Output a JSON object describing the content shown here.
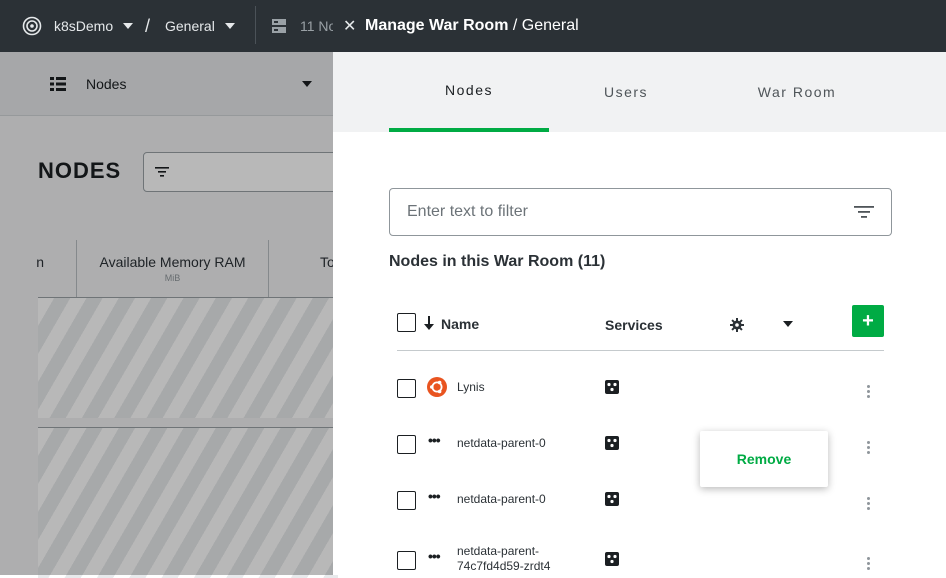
{
  "topbar": {
    "space": "k8sDemo",
    "separator": "/",
    "room": "General",
    "nodes_count_partial": "11 No"
  },
  "background": {
    "view_selector": "Nodes",
    "page_title": "NODES",
    "columns": [
      {
        "label": "n",
        "unit": ""
      },
      {
        "label": "Available Memory RAM",
        "unit": "MiB"
      },
      {
        "label": "To",
        "unit": ""
      }
    ]
  },
  "panel": {
    "title": "Manage War Room",
    "room_suffix": " / General",
    "tabs": [
      {
        "label": "Nodes",
        "active": true
      },
      {
        "label": "Users",
        "active": false
      },
      {
        "label": "War Room",
        "active": false
      }
    ],
    "filter_placeholder": "Enter text to filter",
    "section_title": "Nodes in this War Room (11)",
    "table": {
      "headers": {
        "name": "Name",
        "services": "Services"
      },
      "add_label": "+",
      "rows": [
        {
          "name": "Lynis",
          "icon": "ubuntu-icon"
        },
        {
          "name": "netdata-parent-0",
          "icon": "dots-icon"
        },
        {
          "name": "netdata-parent-0",
          "icon": "dots-icon"
        },
        {
          "name": "netdata-parent-",
          "name2": "74c7fd4d59-zrdt4",
          "icon": "dots-icon"
        }
      ]
    },
    "popover": {
      "label": "Remove"
    }
  },
  "colors": {
    "accent": "#00ab44",
    "header_bg": "#2b3136",
    "ubuntu": "#e95420"
  }
}
